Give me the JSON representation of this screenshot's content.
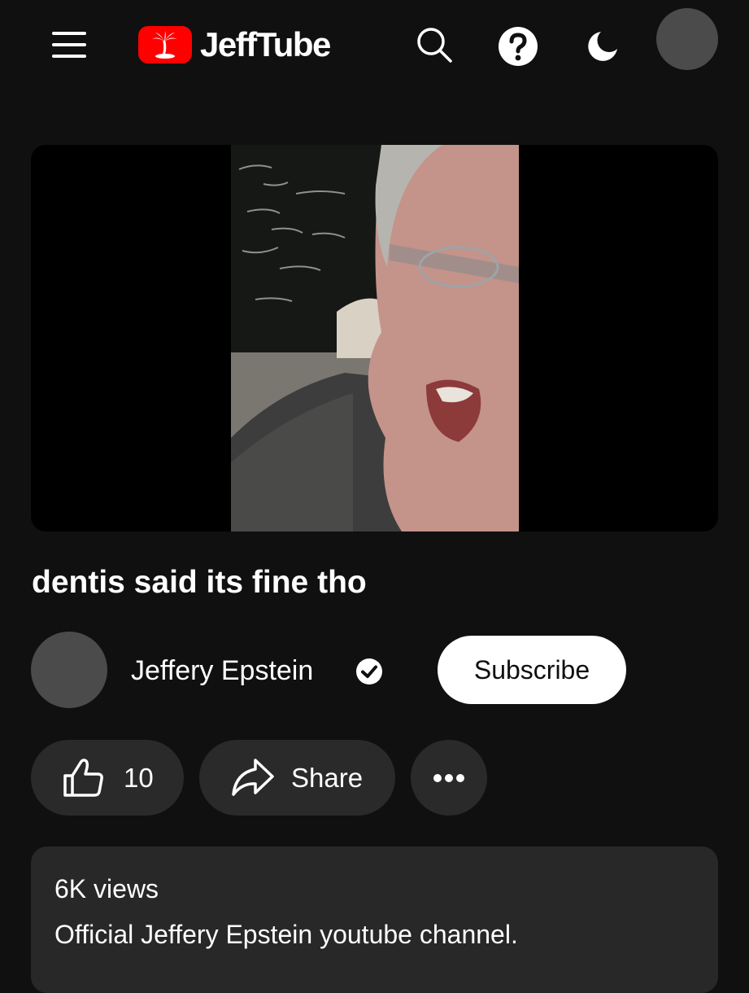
{
  "app": {
    "logo_text": "JeffTube",
    "brand_color": "#ff0000",
    "background_color": "#101010"
  },
  "header": {
    "menu_icon": "hamburger-menu-icon",
    "logo_icon": "palm-tree-island-icon",
    "search_icon": "search-icon",
    "help_icon": "help-circle-icon",
    "theme_icon": "moon-icon",
    "avatar_icon": "user-avatar"
  },
  "video": {
    "title": "dentis said its fine tho"
  },
  "channel": {
    "name": "Jeffery Epstein",
    "verified_icon": "verified-check-icon",
    "subscribe_label": "Subscribe"
  },
  "actions": {
    "like_icon": "thumbs-up-icon",
    "like_count": "10",
    "share_icon": "share-arrow-icon",
    "share_label": "Share",
    "more_icon": "more-horizontal-icon"
  },
  "description": {
    "views": "6K views",
    "text": "Official Jeffery Epstein youtube channel."
  }
}
